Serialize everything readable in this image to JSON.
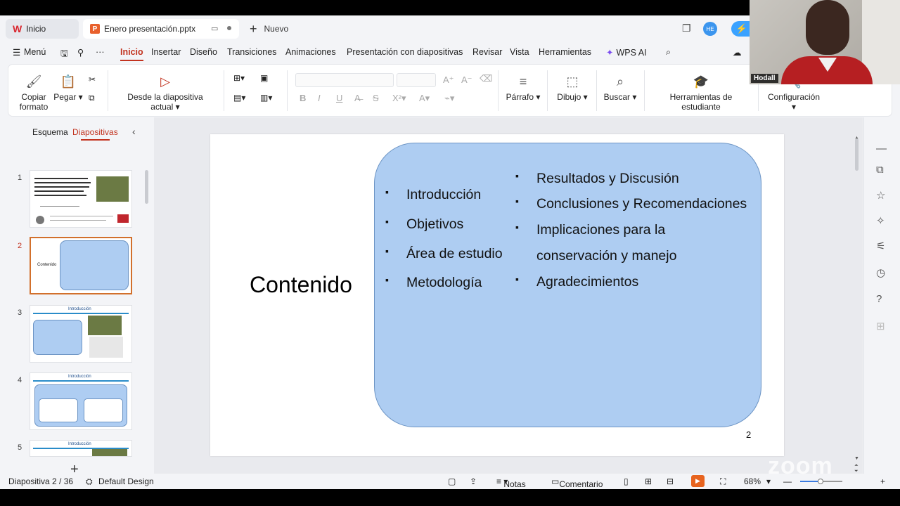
{
  "tabs": {
    "home": "Inicio",
    "document": "Enero presentación.pptx",
    "new": "Nuevo",
    "user_initials": "HE"
  },
  "menu": {
    "menu_label": "Menú",
    "items": [
      "Inicio",
      "Insertar",
      "Diseño",
      "Transiciones",
      "Animaciones",
      "Presentación con diapositivas",
      "Revisar",
      "Vista",
      "Herramientas",
      "WPS AI"
    ]
  },
  "ribbon": {
    "copy_format_line1": "Copiar",
    "copy_format_line2": "formato",
    "paste": "Pegar",
    "from_current": "Desde la diapositiva actual",
    "paragraph": "Párrafo",
    "drawing": "Dibujo",
    "find": "Buscar",
    "student_tools": "Herramientas de estudiante",
    "settings": "Configuración"
  },
  "panel": {
    "outline_tab": "Esquema",
    "slides_tab": "Diapositivas",
    "slide_numbers": [
      "1",
      "2",
      "3",
      "4",
      "5"
    ]
  },
  "slide": {
    "title": "Contenido",
    "left_items": [
      "Introducción",
      "Objetivos",
      "Área de estudio",
      "Metodología"
    ],
    "right_items": [
      "Resultados y Discusión",
      "Conclusiones y Recomendaciones",
      "Implicaciones para la",
      "conservación y manejo",
      "Agradecimientos"
    ],
    "page_number": "2"
  },
  "thumbs": {
    "t2_title": "Contenido",
    "t3_title": "Introducción",
    "t4_title": "Introducción",
    "t5_title": "Introducción"
  },
  "status": {
    "slide_indicator": "Diapositiva  2 / 36",
    "design": "Default Design",
    "notes": "Notas",
    "comment": "Comentario",
    "zoom": "68%",
    "zoom_fraction": 0.68
  },
  "webcam": {
    "name": "Hodall"
  },
  "watermark": "zoom"
}
